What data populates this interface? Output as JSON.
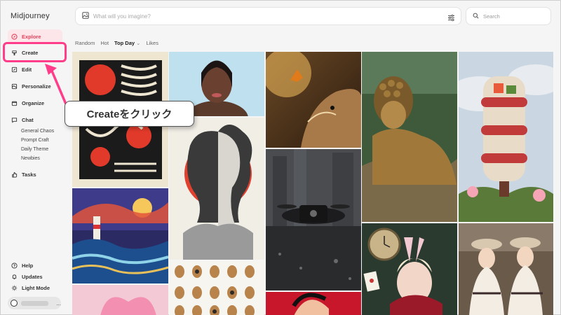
{
  "app": {
    "title": "Midjourney"
  },
  "nav": {
    "explore": "Explore",
    "create": "Create",
    "edit": "Edit",
    "personalize": "Personalize",
    "organize": "Organize",
    "chat": "Chat",
    "chat_channels": [
      "General Chaos",
      "Prompt Craft",
      "Daily Theme",
      "Newbies"
    ],
    "tasks": "Tasks",
    "help": "Help",
    "updates": "Updates",
    "light_mode": "Light Mode",
    "profile_more": "..."
  },
  "imagine": {
    "placeholder": "What will you imagine?"
  },
  "search": {
    "placeholder": "Search"
  },
  "filters": {
    "random": "Random",
    "hot": "Hot",
    "top_day": "Top Day",
    "top_day_chevron": "⌄",
    "likes": "Likes"
  },
  "annotation": {
    "callout_text": "Createをクリック"
  },
  "colors": {
    "accent": "#e8405a",
    "highlight": "#ff3d8a"
  },
  "icons": [
    "explore-icon",
    "create-icon",
    "edit-icon",
    "personalize-icon",
    "organize-icon",
    "chat-icon",
    "tasks-icon",
    "help-icon",
    "updates-icon",
    "light-mode-icon",
    "image-icon",
    "sliders-icon",
    "search-icon"
  ]
}
